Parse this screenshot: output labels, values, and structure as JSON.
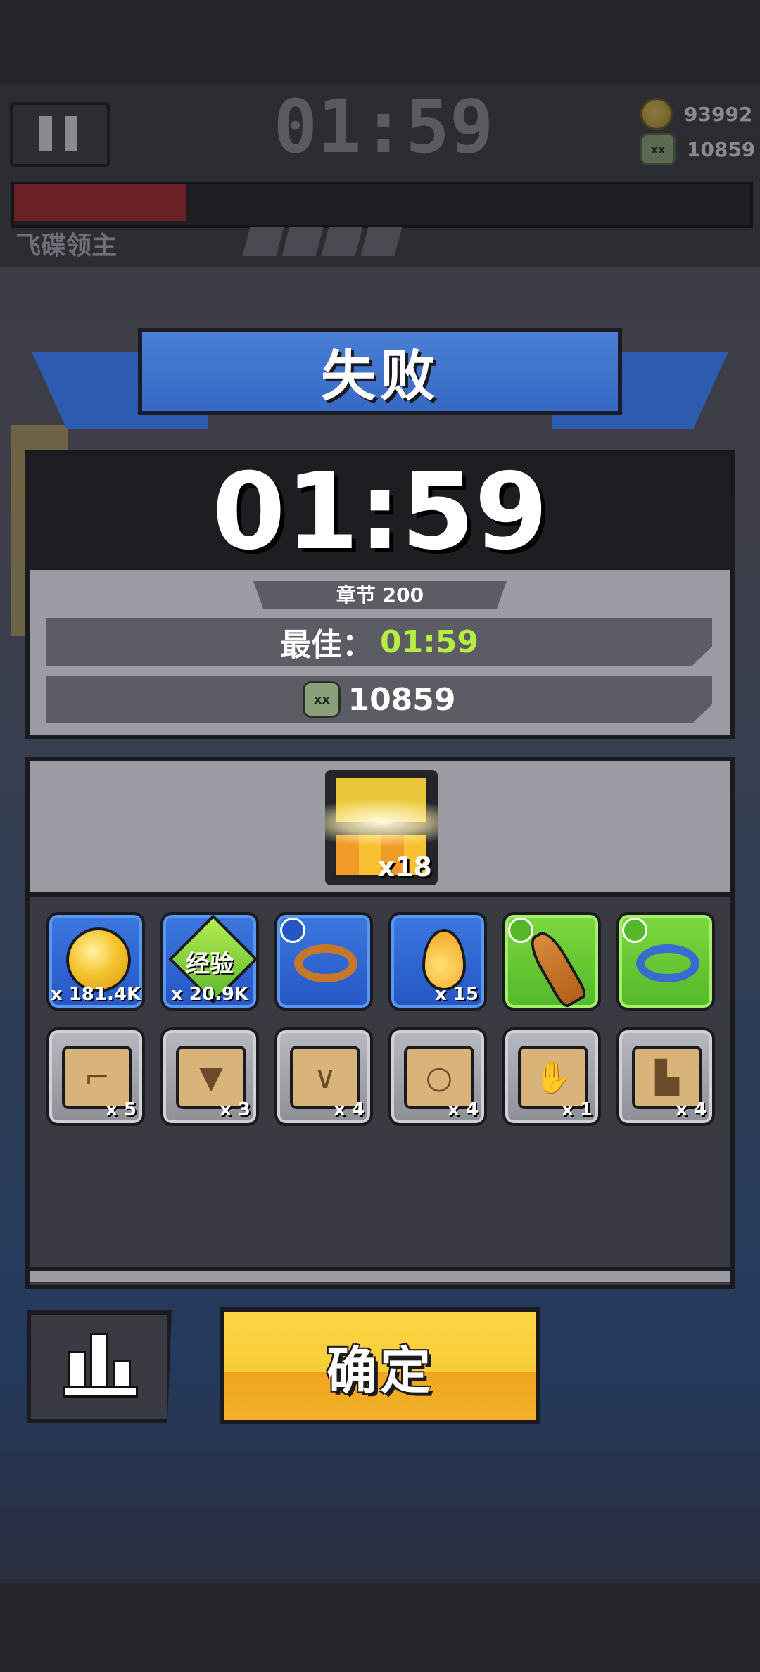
{
  "hud": {
    "timer": "01:59",
    "coins": "93992",
    "kills": "10859",
    "boss_name": "飞碟领主"
  },
  "result": {
    "title": "失败",
    "time": "01:59",
    "chapter": "章节 200",
    "best_label": "最佳：",
    "best_value": "01:59",
    "kills": "10859"
  },
  "rewards": {
    "chest_count": "x18",
    "items": [
      {
        "icon": "gold-coin-icon",
        "tier": "blue",
        "qty": "x 181.4K"
      },
      {
        "icon": "exp-gem-icon",
        "tier": "blue",
        "qty": "x 20.9K",
        "label": "经验"
      },
      {
        "icon": "leather-belt-icon",
        "tier": "blue",
        "qty": ""
      },
      {
        "icon": "golden-drop-icon",
        "tier": "blue",
        "qty": "x 15"
      },
      {
        "icon": "baseball-bat-icon",
        "tier": "green",
        "qty": ""
      },
      {
        "icon": "blue-belt-icon",
        "tier": "green",
        "qty": ""
      },
      {
        "icon": "gun-scroll-icon",
        "tier": "gray",
        "qty": "x 5"
      },
      {
        "icon": "armor-scroll-icon",
        "tier": "gray",
        "qty": "x 3"
      },
      {
        "icon": "necklace-scroll-icon",
        "tier": "gray",
        "qty": "x 4"
      },
      {
        "icon": "belt-scroll-icon",
        "tier": "gray",
        "qty": "x 4"
      },
      {
        "icon": "glove-scroll-icon",
        "tier": "gray",
        "qty": "x 1"
      },
      {
        "icon": "boots-scroll-icon",
        "tier": "gray",
        "qty": "x 4"
      }
    ]
  },
  "buttons": {
    "confirm": "确定"
  },
  "colors": {
    "ribbon_blue": "#3669c4",
    "best_green": "#b6ec43",
    "confirm_yellow": "#f8cc38"
  }
}
